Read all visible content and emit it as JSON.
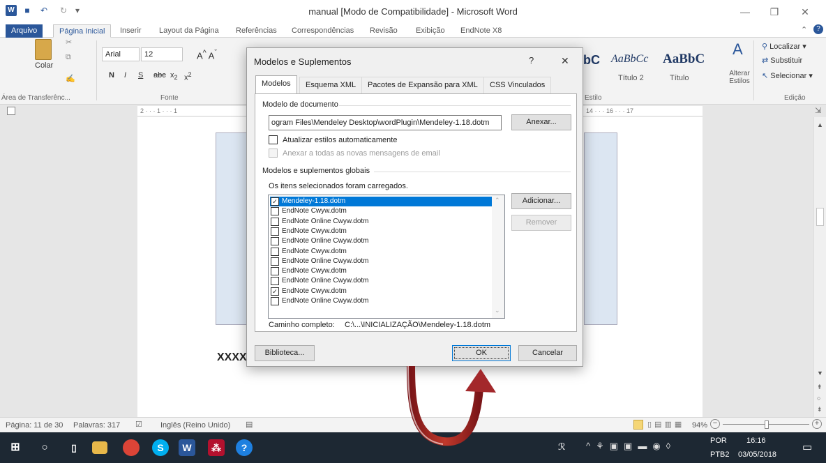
{
  "window": {
    "title": "manual [Modo de Compatibilidade] - Microsoft Word"
  },
  "ribbon_tabs": [
    "Arquivo",
    "Página Inicial",
    "Inserir",
    "Layout da Página",
    "Referências",
    "Correspondências",
    "Revisão",
    "Exibição",
    "EndNote X8"
  ],
  "ribbon": {
    "paste_label": "Colar",
    "font_name": "Arial",
    "font_size": "12",
    "group_clipboard": "Área de Transferênc...",
    "group_font": "Fonte",
    "group_style": "Estilo",
    "group_edit": "Edição",
    "style_previews": [
      "AaBbCc",
      "AaBbC"
    ],
    "style_partial": "bC",
    "style_titles": [
      "Título 2",
      "Título"
    ],
    "change_styles": "Alterar Estilos",
    "find": "Localizar",
    "replace": "Substituir",
    "select": "Selecionar"
  },
  "document": {
    "text": "XXXX"
  },
  "ruler": {
    "left": "2 · · · 1 · · · 1",
    "right": "14 · · · 16 · · · 17"
  },
  "dialog": {
    "title": "Modelos e Suplementos",
    "help": "?",
    "close": "✕",
    "tabs": [
      "Modelos",
      "Esquema XML",
      "Pacotes de Expansão para XML",
      "CSS Vinculados"
    ],
    "template_group": "Modelo de documento",
    "template_path": "ogram Files\\Mendeley Desktop\\wordPlugin\\Mendeley-1.18.dotm",
    "attach": "Anexar...",
    "auto_update": "Atualizar estilos automaticamente",
    "attach_all": "Anexar a todas as novas mensagens de email",
    "global_group": "Modelos e suplementos globais",
    "loaded_msg": "Os itens selecionados foram carregados.",
    "items": [
      {
        "label": "Mendeley-1.18.dotm",
        "checked": true,
        "selected": true
      },
      {
        "label": "EndNote Cwyw.dotm",
        "checked": false
      },
      {
        "label": "EndNote Online Cwyw.dotm",
        "checked": false
      },
      {
        "label": "EndNote Cwyw.dotm",
        "checked": false
      },
      {
        "label": "EndNote Online Cwyw.dotm",
        "checked": false
      },
      {
        "label": "EndNote Cwyw.dotm",
        "checked": false
      },
      {
        "label": "EndNote Online Cwyw.dotm",
        "checked": false
      },
      {
        "label": "EndNote Cwyw.dotm",
        "checked": false
      },
      {
        "label": "EndNote Online Cwyw.dotm",
        "checked": false
      },
      {
        "label": "EndNote Cwyw.dotm",
        "checked": true
      },
      {
        "label": "EndNote Online Cwyw.dotm",
        "checked": false
      }
    ],
    "add": "Adicionar...",
    "remove": "Remover",
    "full_path_label": "Caminho completo:",
    "full_path": "C:\\...\\INICIALIZAÇÃO\\Mendeley-1.18.dotm",
    "library": "Biblioteca...",
    "ok": "OK",
    "cancel": "Cancelar"
  },
  "status": {
    "page": "Página: 11 de 30",
    "words": "Palavras: 317",
    "language": "Inglês (Reino Unido)",
    "zoom": "94%"
  },
  "taskbar": {
    "lang1": "POR",
    "lang2": "PTB2",
    "time": "16:16",
    "date": "03/05/2018"
  },
  "colors": {
    "word_blue": "#2b579a",
    "taskbar": "#1d2833",
    "arrow": "#a3282b",
    "selection": "#0078d7"
  }
}
